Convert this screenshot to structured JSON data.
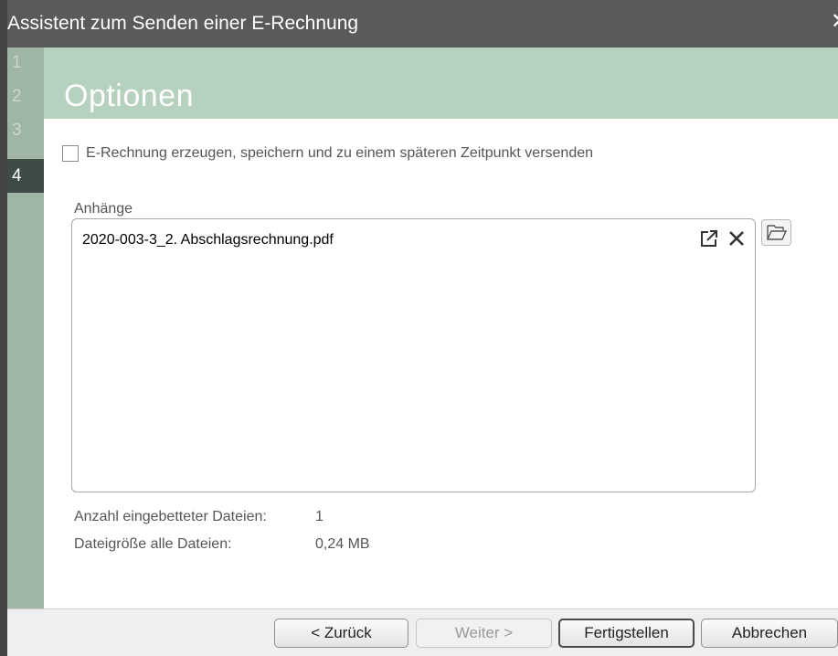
{
  "window": {
    "title": "Assistent zum Senden einer E-Rechnung",
    "close_glyph": "✕"
  },
  "steps": [
    "1",
    "2",
    "3",
    "4"
  ],
  "active_step": "4",
  "page": {
    "title": "Optionen"
  },
  "options": {
    "create_later_label": "E-Rechnung erzeugen, speichern und zu einem späteren Zeitpunkt versenden",
    "create_later_checked": false
  },
  "attachments": {
    "label": "Anhänge",
    "items": [
      "2020-003-3_2. Abschlagsrechnung.pdf"
    ]
  },
  "info": {
    "count_label": "Anzahl eingebetteter Dateien:",
    "count_value": "1",
    "size_label": "Dateigröße alle Dateien:",
    "size_value": "0,24 MB"
  },
  "footer": {
    "back_label": "< Zurück",
    "next_label": "Weiter >",
    "finish_label": "Fertigstellen",
    "cancel_label": "Abbrechen"
  },
  "colors": {
    "title_bar": "#5a5a5a",
    "step_rail": "#9fb5a6",
    "active_step": "#3d4c44",
    "header_band": "#b6d1bd"
  },
  "icons": [
    "close-icon",
    "open-external-icon",
    "remove-icon",
    "folder-open-icon"
  ]
}
